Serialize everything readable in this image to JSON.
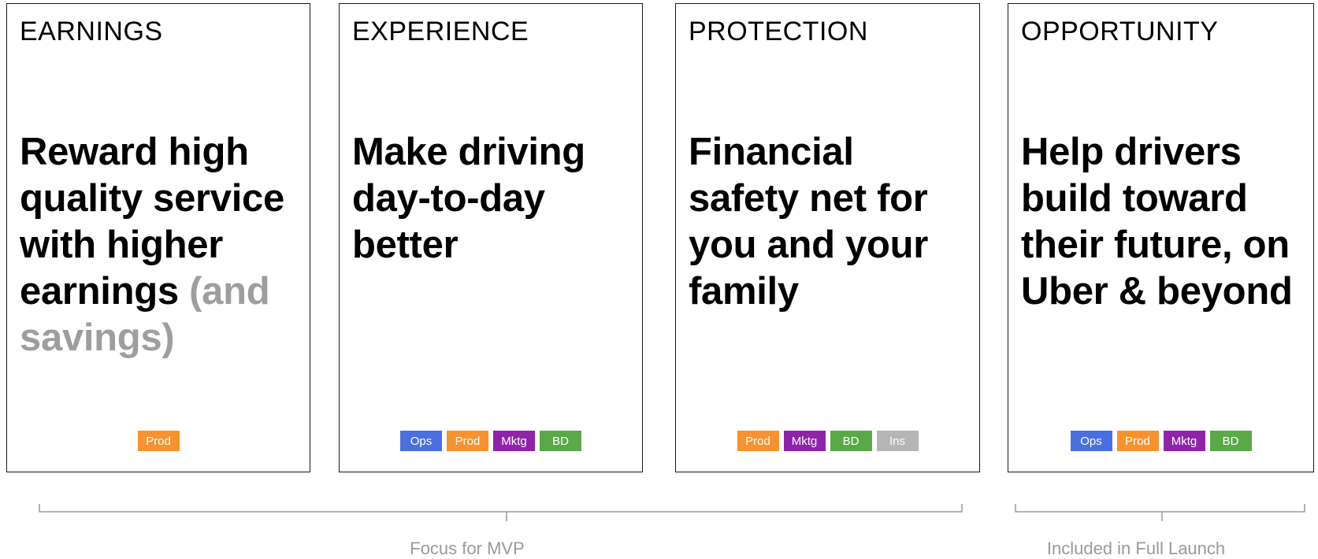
{
  "cards": [
    {
      "title": "EARNINGS",
      "body_main": "Reward high quality service with higher earnings ",
      "body_muted": "(and savings)",
      "tags": [
        {
          "label": "Prod",
          "color": "#f7922f"
        }
      ]
    },
    {
      "title": "EXPERIENCE",
      "body_main": "Make driving day-to-day better",
      "body_muted": "",
      "tags": [
        {
          "label": "Ops",
          "color": "#4a6fe0"
        },
        {
          "label": "Prod",
          "color": "#f7922f"
        },
        {
          "label": "Mktg",
          "color": "#8e24aa"
        },
        {
          "label": "BD",
          "color": "#5aa847"
        }
      ]
    },
    {
      "title": "PROTECTION",
      "body_main": "Financial safety net for you and your family",
      "body_muted": "",
      "tags": [
        {
          "label": "Prod",
          "color": "#f7922f"
        },
        {
          "label": "Mktg",
          "color": "#8e24aa"
        },
        {
          "label": "BD",
          "color": "#5aa847"
        },
        {
          "label": "Ins",
          "color": "#b5b5b5"
        }
      ]
    },
    {
      "title": "OPPORTUNITY",
      "body_main": "Help drivers build toward their future, on Uber & beyond",
      "body_muted": "",
      "tags": [
        {
          "label": "Ops",
          "color": "#4a6fe0"
        },
        {
          "label": "Prod",
          "color": "#f7922f"
        },
        {
          "label": "Mktg",
          "color": "#8e24aa"
        },
        {
          "label": "BD",
          "color": "#5aa847"
        }
      ]
    }
  ],
  "brackets": {
    "mvp_label": "Focus for MVP",
    "full_launch_label": "Included in Full Launch"
  },
  "colors": {
    "ops": "#4a6fe0",
    "prod": "#f7922f",
    "mktg": "#8e24aa",
    "bd": "#5aa847",
    "ins": "#b5b5b5",
    "muted_text": "#9e9e9e",
    "bracket": "#9a9a9a"
  }
}
